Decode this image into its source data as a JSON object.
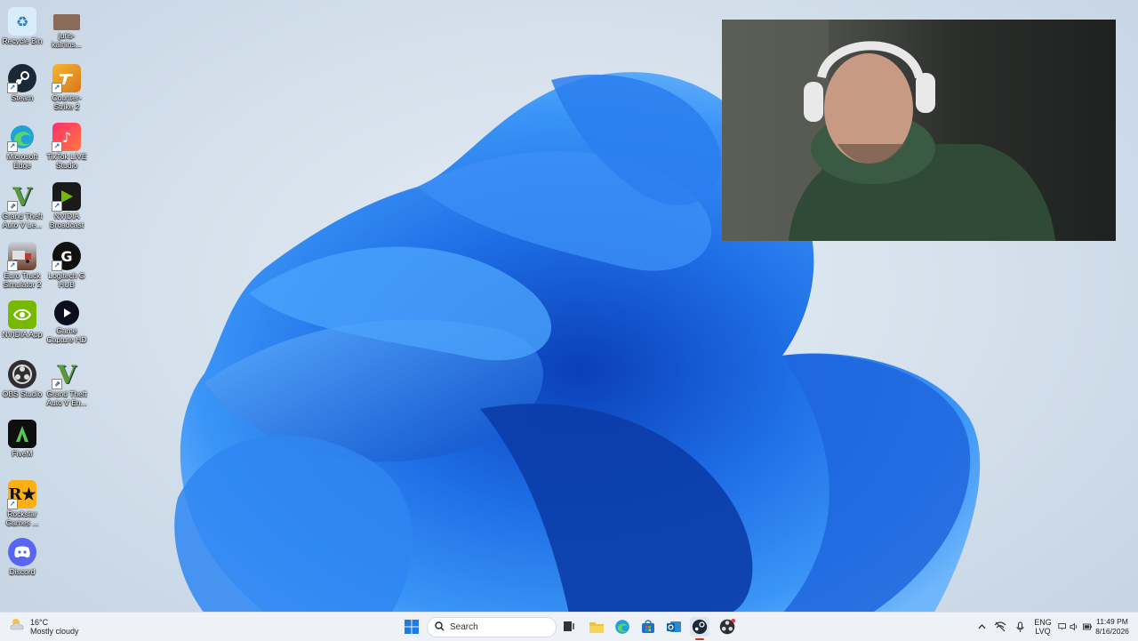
{
  "desktop": {
    "icons": [
      {
        "label": "Recycle Bin",
        "icon": "recycle-bin-icon",
        "color": "#9fc6e6"
      },
      {
        "label": "juris-kalnins...",
        "icon": "profile-photo-icon",
        "color": "#8a6a58"
      },
      {
        "label": "Steam",
        "icon": "steam-icon",
        "color": "#1b2838"
      },
      {
        "label": "Counter-Strike 2",
        "icon": "counter-strike-icon",
        "color": "#e6a020"
      },
      {
        "label": "Microsoft Edge",
        "icon": "edge-icon",
        "color": "#1fa2d6"
      },
      {
        "label": "TikTok LIVE Studio",
        "icon": "tiktok-icon",
        "color": "#fe2c55"
      },
      {
        "label": "Grand Theft Auto V Le...",
        "icon": "gta-v-icon",
        "color": "#3c6b2b"
      },
      {
        "label": "NVIDIA Broadcast",
        "icon": "nvidia-broadcast-icon",
        "color": "#1a1a1a"
      },
      {
        "label": "Euro Truck Simulator 2",
        "icon": "euro-truck-icon",
        "color": "#6b3f2a"
      },
      {
        "label": "Logitech G HUB",
        "icon": "logitech-g-icon",
        "color": "#111111"
      },
      {
        "label": "NVIDIA App",
        "icon": "nvidia-app-icon",
        "color": "#76b900"
      },
      {
        "label": "Game Capture HD",
        "icon": "game-capture-icon",
        "color": "#0d0d20"
      },
      {
        "label": "OBS Studio",
        "icon": "obs-icon",
        "color": "#302e31"
      },
      {
        "label": "Grand Theft Auto V En...",
        "icon": "gta-v-enhanced-icon",
        "color": "#3c6b2b"
      },
      {
        "label": "FiveM",
        "icon": "fivem-icon",
        "color": "#0e0e0e"
      },
      {
        "label": "Rockstar Games ...",
        "icon": "rockstar-icon",
        "color": "#fcaf17"
      },
      {
        "label": "Discord",
        "icon": "discord-icon",
        "color": "#5865f2"
      }
    ]
  },
  "taskbar": {
    "weather": {
      "temp": "16°C",
      "condition": "Mostly cloudy"
    },
    "search_placeholder": "Search",
    "language": {
      "line1": "ENG",
      "line2": "LVQ"
    },
    "clock": {
      "time": "11:49 PM",
      "date": "8/16/2026"
    }
  }
}
